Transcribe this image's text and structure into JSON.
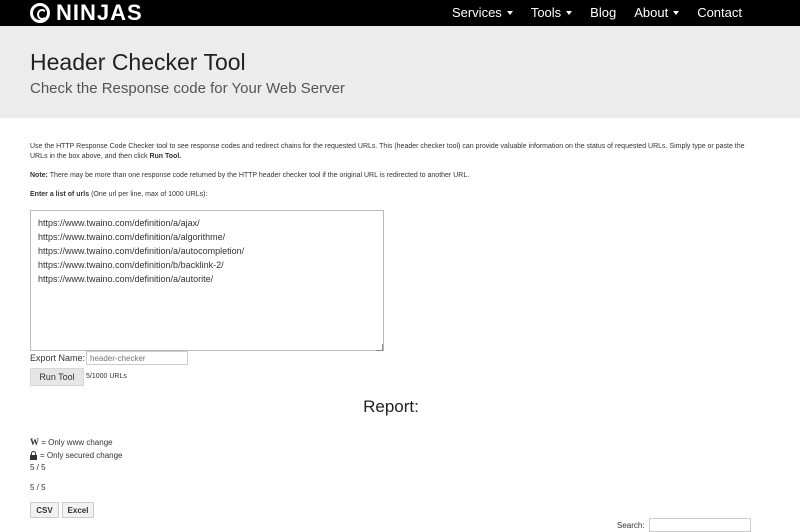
{
  "nav": {
    "logo_text": "NINJAS",
    "menu": [
      {
        "label": "Services",
        "dropdown": true
      },
      {
        "label": "Tools",
        "dropdown": true
      },
      {
        "label": "Blog",
        "dropdown": false
      },
      {
        "label": "About",
        "dropdown": true
      },
      {
        "label": "Contact",
        "dropdown": false
      }
    ]
  },
  "hero": {
    "title": "Header Checker Tool",
    "subtitle": "Check the Response code for Your Web Server"
  },
  "intro": {
    "text_main": "Use the HTTP Response Code Checker tool to see response codes and redirect chains for the requested URLs. This (header checker tool) can provide valuable information on the status of requested URLs. Simply type or paste the URLs in the box above, and then click ",
    "text_bold": "Run Tool."
  },
  "note": {
    "label": "Note:",
    "text": " There may be more than one response code returned by the HTTP header checker tool if the original URL is redirected to another URL."
  },
  "urls_label": {
    "bold": "Enter a list of urls",
    "rest": " (One url per line, max of 1000 URLs):"
  },
  "urls_value": "https://www.twaino.com/definition/a/ajax/\nhttps://www.twaino.com/definition/a/algorithme/\nhttps://www.twaino.com/definition/a/autocompletion/\nhttps://www.twaino.com/definition/b/backlink-2/\nhttps://www.twaino.com/definition/a/autorite/",
  "export": {
    "label": "Export Name:",
    "placeholder": "header-checker"
  },
  "run_button": "Run Tool",
  "url_counter": "5/1000 URLs",
  "report": {
    "title": "Report:",
    "legend_www_symbol": "W",
    "legend_www_text": " = Only www change",
    "legend_secure_text": "= Only secured change",
    "count_1": "5 / 5",
    "count_2": "5 / 5"
  },
  "export_buttons": {
    "csv": "CSV",
    "excel": "Excel"
  },
  "search": {
    "label": "Search:"
  }
}
